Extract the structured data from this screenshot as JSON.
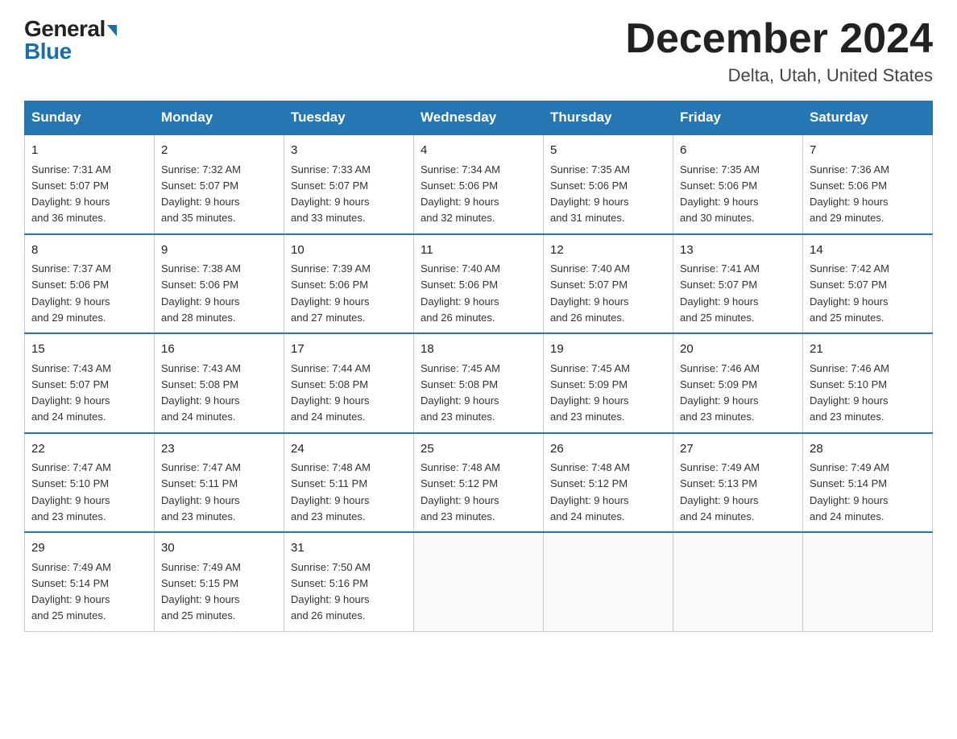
{
  "logo": {
    "general": "General",
    "blue": "Blue"
  },
  "header": {
    "month_title": "December 2024",
    "location": "Delta, Utah, United States"
  },
  "weekdays": [
    "Sunday",
    "Monday",
    "Tuesday",
    "Wednesday",
    "Thursday",
    "Friday",
    "Saturday"
  ],
  "weeks": [
    [
      {
        "day": "1",
        "sunrise": "7:31 AM",
        "sunset": "5:07 PM",
        "daylight": "9 hours and 36 minutes."
      },
      {
        "day": "2",
        "sunrise": "7:32 AM",
        "sunset": "5:07 PM",
        "daylight": "9 hours and 35 minutes."
      },
      {
        "day": "3",
        "sunrise": "7:33 AM",
        "sunset": "5:07 PM",
        "daylight": "9 hours and 33 minutes."
      },
      {
        "day": "4",
        "sunrise": "7:34 AM",
        "sunset": "5:06 PM",
        "daylight": "9 hours and 32 minutes."
      },
      {
        "day": "5",
        "sunrise": "7:35 AM",
        "sunset": "5:06 PM",
        "daylight": "9 hours and 31 minutes."
      },
      {
        "day": "6",
        "sunrise": "7:35 AM",
        "sunset": "5:06 PM",
        "daylight": "9 hours and 30 minutes."
      },
      {
        "day": "7",
        "sunrise": "7:36 AM",
        "sunset": "5:06 PM",
        "daylight": "9 hours and 29 minutes."
      }
    ],
    [
      {
        "day": "8",
        "sunrise": "7:37 AM",
        "sunset": "5:06 PM",
        "daylight": "9 hours and 29 minutes."
      },
      {
        "day": "9",
        "sunrise": "7:38 AM",
        "sunset": "5:06 PM",
        "daylight": "9 hours and 28 minutes."
      },
      {
        "day": "10",
        "sunrise": "7:39 AM",
        "sunset": "5:06 PM",
        "daylight": "9 hours and 27 minutes."
      },
      {
        "day": "11",
        "sunrise": "7:40 AM",
        "sunset": "5:06 PM",
        "daylight": "9 hours and 26 minutes."
      },
      {
        "day": "12",
        "sunrise": "7:40 AM",
        "sunset": "5:07 PM",
        "daylight": "9 hours and 26 minutes."
      },
      {
        "day": "13",
        "sunrise": "7:41 AM",
        "sunset": "5:07 PM",
        "daylight": "9 hours and 25 minutes."
      },
      {
        "day": "14",
        "sunrise": "7:42 AM",
        "sunset": "5:07 PM",
        "daylight": "9 hours and 25 minutes."
      }
    ],
    [
      {
        "day": "15",
        "sunrise": "7:43 AM",
        "sunset": "5:07 PM",
        "daylight": "9 hours and 24 minutes."
      },
      {
        "day": "16",
        "sunrise": "7:43 AM",
        "sunset": "5:08 PM",
        "daylight": "9 hours and 24 minutes."
      },
      {
        "day": "17",
        "sunrise": "7:44 AM",
        "sunset": "5:08 PM",
        "daylight": "9 hours and 24 minutes."
      },
      {
        "day": "18",
        "sunrise": "7:45 AM",
        "sunset": "5:08 PM",
        "daylight": "9 hours and 23 minutes."
      },
      {
        "day": "19",
        "sunrise": "7:45 AM",
        "sunset": "5:09 PM",
        "daylight": "9 hours and 23 minutes."
      },
      {
        "day": "20",
        "sunrise": "7:46 AM",
        "sunset": "5:09 PM",
        "daylight": "9 hours and 23 minutes."
      },
      {
        "day": "21",
        "sunrise": "7:46 AM",
        "sunset": "5:10 PM",
        "daylight": "9 hours and 23 minutes."
      }
    ],
    [
      {
        "day": "22",
        "sunrise": "7:47 AM",
        "sunset": "5:10 PM",
        "daylight": "9 hours and 23 minutes."
      },
      {
        "day": "23",
        "sunrise": "7:47 AM",
        "sunset": "5:11 PM",
        "daylight": "9 hours and 23 minutes."
      },
      {
        "day": "24",
        "sunrise": "7:48 AM",
        "sunset": "5:11 PM",
        "daylight": "9 hours and 23 minutes."
      },
      {
        "day": "25",
        "sunrise": "7:48 AM",
        "sunset": "5:12 PM",
        "daylight": "9 hours and 23 minutes."
      },
      {
        "day": "26",
        "sunrise": "7:48 AM",
        "sunset": "5:12 PM",
        "daylight": "9 hours and 24 minutes."
      },
      {
        "day": "27",
        "sunrise": "7:49 AM",
        "sunset": "5:13 PM",
        "daylight": "9 hours and 24 minutes."
      },
      {
        "day": "28",
        "sunrise": "7:49 AM",
        "sunset": "5:14 PM",
        "daylight": "9 hours and 24 minutes."
      }
    ],
    [
      {
        "day": "29",
        "sunrise": "7:49 AM",
        "sunset": "5:14 PM",
        "daylight": "9 hours and 25 minutes."
      },
      {
        "day": "30",
        "sunrise": "7:49 AM",
        "sunset": "5:15 PM",
        "daylight": "9 hours and 25 minutes."
      },
      {
        "day": "31",
        "sunrise": "7:50 AM",
        "sunset": "5:16 PM",
        "daylight": "9 hours and 26 minutes."
      },
      null,
      null,
      null,
      null
    ]
  ]
}
